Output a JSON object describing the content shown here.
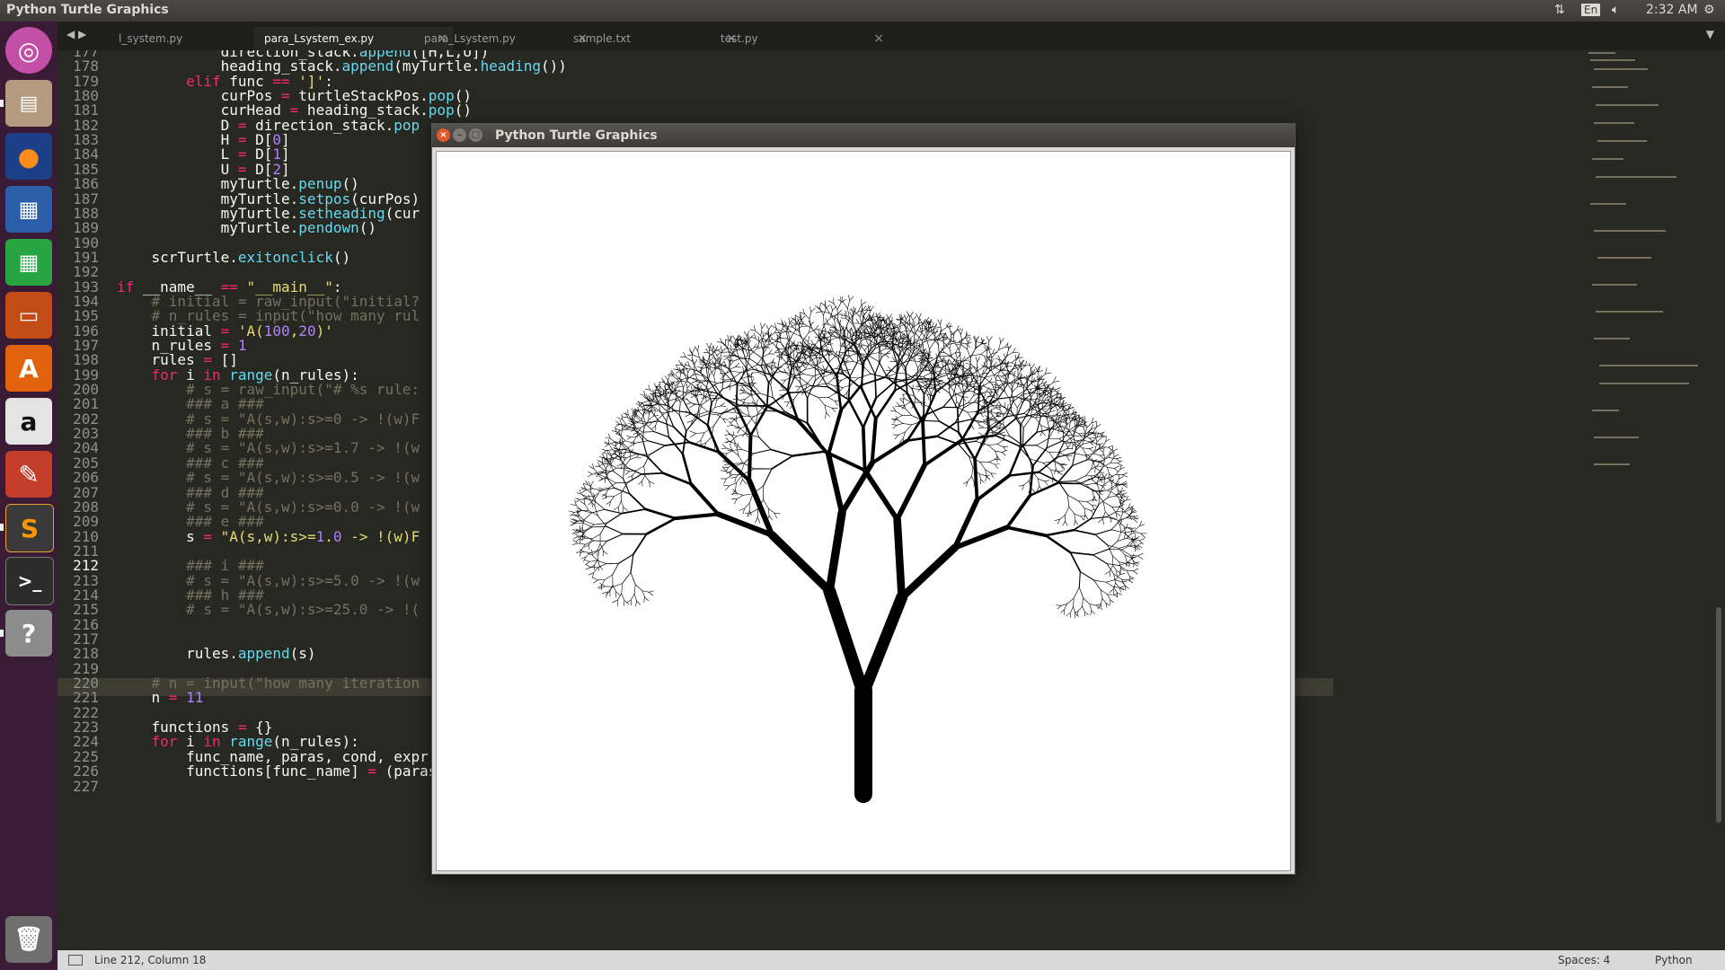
{
  "top_panel": {
    "app_title": "Python Turtle Graphics",
    "keyboard_layout": "En",
    "clock": "2:32 AM",
    "icons": [
      "transfer-arrows-icon",
      "keyboard-icon",
      "volume-icon",
      "gear-icon"
    ]
  },
  "launcher": {
    "items": [
      {
        "name": "ubuntu-dash",
        "icon": "ubuntu-logo-icon",
        "color": "#c34fa7"
      },
      {
        "name": "files",
        "icon": "file-cabinet-icon",
        "color": "#c8b9a6"
      },
      {
        "name": "firefox",
        "icon": "firefox-icon",
        "color": "#e66000"
      },
      {
        "name": "writer",
        "icon": "document-icon",
        "color": "#2a5ea8"
      },
      {
        "name": "calc",
        "icon": "spreadsheet-icon",
        "color": "#27a543"
      },
      {
        "name": "impress",
        "icon": "presentation-icon",
        "color": "#c24b16"
      },
      {
        "name": "software-center",
        "icon": "shopping-bag-icon",
        "color": "#e2630d"
      },
      {
        "name": "amazon",
        "icon": "amazon-icon",
        "color": "#e4e4e4"
      },
      {
        "name": "settings",
        "icon": "wrench-gear-icon",
        "color": "#c43d2b"
      },
      {
        "name": "sublime-text",
        "icon": "sublime-icon",
        "color": "#4a4a4a"
      },
      {
        "name": "terminal",
        "icon": "terminal-icon",
        "color": "#2c2c2c"
      },
      {
        "name": "help",
        "icon": "question-icon",
        "color": "#8c8c8c"
      },
      {
        "name": "trash",
        "icon": "trash-icon",
        "color": "#8a8a8a"
      }
    ]
  },
  "tabs": [
    {
      "label": "l_system.py",
      "active": false
    },
    {
      "label": "para_Lsystem_ex.py",
      "active": true
    },
    {
      "label": "para_Lsystem.py",
      "active": false
    },
    {
      "label": "sample.txt",
      "active": false
    },
    {
      "label": "test.py",
      "active": false
    }
  ],
  "editor": {
    "lines": [
      {
        "n": "177",
        "code": "            direction_stack.append([H,L,U])"
      },
      {
        "n": "178",
        "code": "            heading_stack.append(myTurtle.heading())"
      },
      {
        "n": "179",
        "code": "        elif func == ']':"
      },
      {
        "n": "180",
        "code": "            curPos = turtleStackPos.pop()"
      },
      {
        "n": "181",
        "code": "            curHead = heading_stack.pop()"
      },
      {
        "n": "182",
        "code": "            D = direction_stack.pop"
      },
      {
        "n": "183",
        "code": "            H = D[0]"
      },
      {
        "n": "184",
        "code": "            L = D[1]"
      },
      {
        "n": "185",
        "code": "            U = D[2]"
      },
      {
        "n": "186",
        "code": "            myTurtle.penup()"
      },
      {
        "n": "187",
        "code": "            myTurtle.setpos(curPos)"
      },
      {
        "n": "188",
        "code": "            myTurtle.setheading(cur"
      },
      {
        "n": "189",
        "code": "            myTurtle.pendown()"
      },
      {
        "n": "190",
        "code": ""
      },
      {
        "n": "191",
        "code": "    scrTurtle.exitonclick()"
      },
      {
        "n": "192",
        "code": ""
      },
      {
        "n": "193",
        "code": "if __name__ == \"__main__\":"
      },
      {
        "n": "194",
        "code": "    # initial = raw_input(\"initial?"
      },
      {
        "n": "195",
        "code": "    # n_rules = input(\"how many rul"
      },
      {
        "n": "196",
        "code": "    initial = 'A(100,20)'"
      },
      {
        "n": "197",
        "code": "    n_rules = 1"
      },
      {
        "n": "198",
        "code": "    rules = []"
      },
      {
        "n": "199",
        "code": "    for i in range(n_rules):"
      },
      {
        "n": "200",
        "code": "        # s = raw_input(\"# %s rule:"
      },
      {
        "n": "201",
        "code": "        ### a ###"
      },
      {
        "n": "202",
        "code": "        # s = \"A(s,w):s>=0 -> !(w)F"
      },
      {
        "n": "203",
        "code": "        ### b ###"
      },
      {
        "n": "204",
        "code": "        # s = \"A(s,w):s>=1.7 -> !(w"
      },
      {
        "n": "205",
        "code": "        ### c ###"
      },
      {
        "n": "206",
        "code": "        # s = \"A(s,w):s>=0.5 -> !(w"
      },
      {
        "n": "207",
        "code": "        ### d ###"
      },
      {
        "n": "208",
        "code": "        # s = \"A(s,w):s>=0.0 -> !(w"
      },
      {
        "n": "209",
        "code": "        ### e ###"
      },
      {
        "n": "210",
        "code": "        s = \"A(s,w):s>=1.0 -> !(w)F"
      },
      {
        "n": "211",
        "code": ""
      },
      {
        "n": "212",
        "code": "        ### i ###"
      },
      {
        "n": "213",
        "code": "        # s = \"A(s,w):s>=5.0 -> !(w"
      },
      {
        "n": "214",
        "code": "        ### h ###"
      },
      {
        "n": "215",
        "code": "        # s = \"A(s,w):s>=25.0 -> !("
      },
      {
        "n": "216",
        "code": ""
      },
      {
        "n": "217",
        "code": ""
      },
      {
        "n": "218",
        "code": "        rules.append(s)"
      },
      {
        "n": "219",
        "code": ""
      },
      {
        "n": "220",
        "code": "    # n = input(\"how many iteration"
      },
      {
        "n": "221",
        "code": "    n = 11"
      },
      {
        "n": "222",
        "code": ""
      },
      {
        "n": "223",
        "code": "    functions = {}"
      },
      {
        "n": "224",
        "code": "    for i in range(n_rules):"
      },
      {
        "n": "225",
        "code": "        func_name, paras, cond, expr = parse(rules[i])"
      },
      {
        "n": "226",
        "code": "        functions[func_name] = (paras, cond, expr)"
      },
      {
        "n": "227",
        "code": ""
      }
    ],
    "current_line": "212"
  },
  "statusbar": {
    "position": "Line 212, Column 18",
    "indent": "Spaces: 4",
    "syntax": "Python"
  },
  "turtle_window": {
    "title": "Python Turtle Graphics"
  }
}
